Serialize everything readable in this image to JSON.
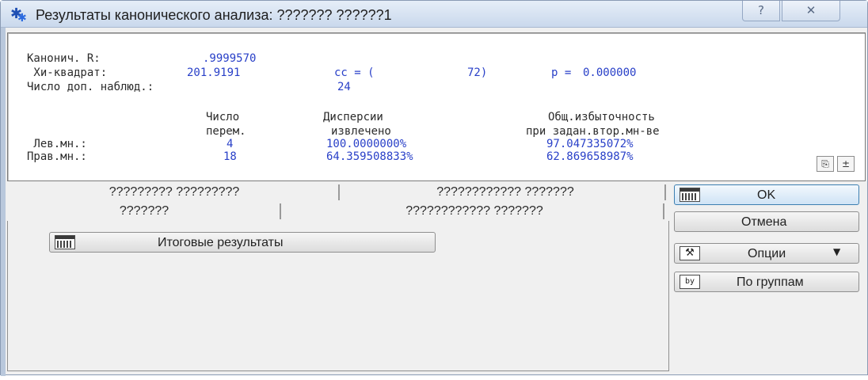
{
  "window": {
    "title": "Результаты канонического анализа: ??????? ??????1",
    "help_glyph": "?",
    "close_glyph": "✕"
  },
  "results": {
    "rows": [
      {
        "label": "Канонич. R:",
        "value": ".9999570"
      },
      {
        "label": " Хи-квадрат:",
        "value": "201.9191",
        "extra_label": "cc = (",
        "extra_value": "72)",
        "p_label": "p =",
        "p_value": "0.000000"
      },
      {
        "label": "Число доп. наблюд.:",
        "value": "24"
      }
    ],
    "table": {
      "col1_header": [
        "Число",
        "перем."
      ],
      "col2_header": [
        "Дисперсии",
        "извлечено"
      ],
      "col3_header": [
        "Общ.избыточность",
        "при задан.втор.мн-ве"
      ],
      "rows": [
        {
          "label": " Лев.мн.:",
          "n": "4",
          "disp": "100.0000000%",
          "red": "97.047335072%"
        },
        {
          "label": "Прав.мн.:",
          "n": "18",
          "disp": "64.359508833%",
          "red": "62.869658987%"
        }
      ]
    },
    "copy_glyph": "⎘",
    "up_glyph": "±"
  },
  "tabs": {
    "row1": [
      "????????? ?????????",
      "???????????? ???????"
    ],
    "row2": [
      "???????",
      "???????????? ???????"
    ]
  },
  "panel": {
    "summary_button": "Итоговые результаты"
  },
  "actions": {
    "ok": "OK",
    "cancel": "Отмена",
    "options": "Опции",
    "by_groups": "По группам"
  }
}
